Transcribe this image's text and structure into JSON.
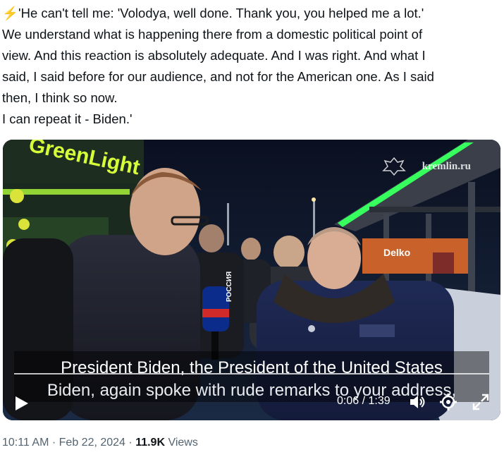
{
  "tweet": {
    "lines": [
      "'He can't tell me: 'Volodya, well done. Thank you, you helped me a lot.'",
      "We understand what is happening there from a domestic political point of",
      "view.  And this reaction is absolutely adequate. And I was right. And what I",
      "said, I said before for our audience, and not for the American one. As I said",
      "then, I think so now.",
      "I can repeat it - Biden.'"
    ],
    "lead_emoji": "⚡"
  },
  "video": {
    "watermark": "kremlin.ru",
    "sign_text": "Delko",
    "store_sign": "GreenLight",
    "mic_label": "РОССИЯ",
    "subtitle_line1": "President Biden, the President of the United States",
    "subtitle_line2": "Biden, again spoke with rude remarks to your address,",
    "time": "0:06 / 1:39",
    "icons": {
      "play": "play-icon",
      "volume": "volume-icon",
      "settings": "gear-icon",
      "fullscreen": "fullscreen-icon"
    }
  },
  "meta": {
    "time": "10:11 AM",
    "separator": "·",
    "date": "Feb 22, 2024",
    "views_count": "11.9K",
    "views_label": "Views"
  }
}
